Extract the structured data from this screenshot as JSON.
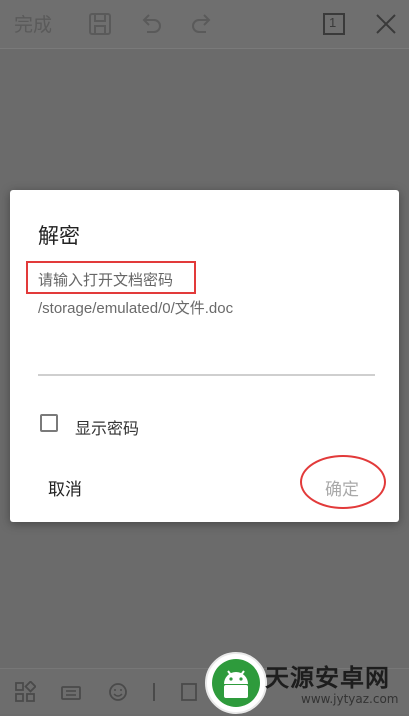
{
  "toolbar": {
    "done_label": "完成",
    "page_indicator": "1",
    "icons": [
      "save-icon",
      "undo-icon",
      "redo-icon",
      "page-count-icon",
      "close-icon"
    ]
  },
  "dialog": {
    "title": "解密",
    "prompt": "请输入打开文档密码",
    "file_path": "/storage/emulated/0/文件.doc",
    "password_value": "",
    "show_password_label": "显示密码",
    "cancel_label": "取消",
    "ok_label": "确定"
  },
  "bottom_bar": {
    "icons": [
      "layout-icon",
      "keyboard-icon",
      "emoji-icon",
      "divider",
      "crop-icon"
    ]
  },
  "watermark": {
    "title": "天源安卓网",
    "url": "www.jytyaz.com"
  },
  "colors": {
    "overlay": "#6b6b6b",
    "dialog_bg": "#ffffff",
    "highlight_red": "#e23a3a",
    "disabled_button": "#a9a9a9"
  }
}
